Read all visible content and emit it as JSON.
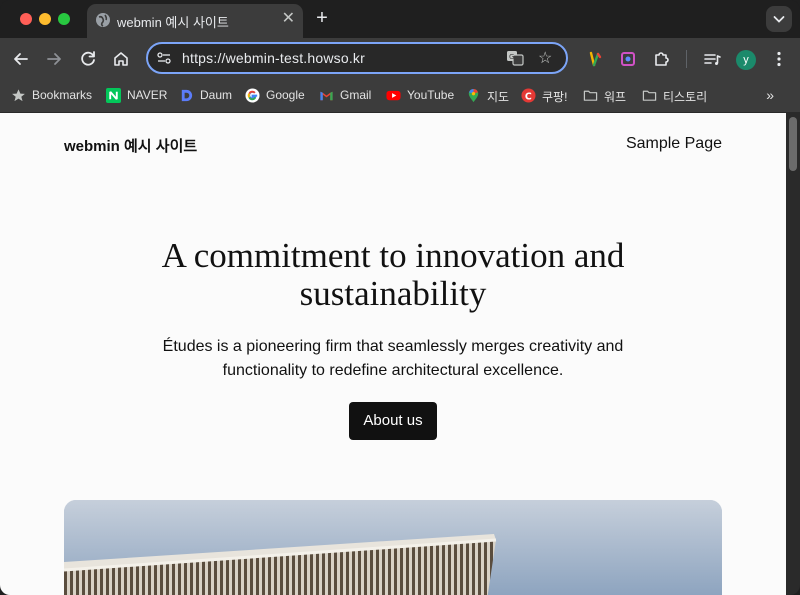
{
  "browser": {
    "tab": {
      "title": "webmin 예시 사이트",
      "close_glyph": "✕"
    },
    "new_tab_glyph": "+",
    "address": {
      "url": "https://webmin-test.howso.kr",
      "star_glyph": "☆"
    },
    "profile_initial": "y",
    "bookmarks": [
      {
        "label": "Bookmarks",
        "icon": "star-icon"
      },
      {
        "label": "NAVER",
        "icon": "naver-icon"
      },
      {
        "label": "Daum",
        "icon": "daum-icon"
      },
      {
        "label": "Google",
        "icon": "google-icon"
      },
      {
        "label": "Gmail",
        "icon": "gmail-icon"
      },
      {
        "label": "YouTube",
        "icon": "youtube-icon"
      },
      {
        "label": "지도",
        "icon": "maps-icon"
      },
      {
        "label": "쿠팡!",
        "icon": "coupang-icon"
      },
      {
        "label": "워프",
        "icon": "folder-icon"
      },
      {
        "label": "티스토리",
        "icon": "folder-icon"
      }
    ],
    "bookmarks_more": "»"
  },
  "page": {
    "site_title": "webmin 예시 사이트",
    "nav_link": "Sample Page",
    "hero_heading": "A commitment to innovation and sustainability",
    "hero_text": "Études is a pioneering firm that seamlessly merges creativity and functionality to redefine architectural excellence.",
    "about_button": "About us"
  },
  "colors": {
    "accent_outline": "#7ca5f8",
    "page_bg": "#fbfbfb",
    "button_bg": "#111111"
  }
}
